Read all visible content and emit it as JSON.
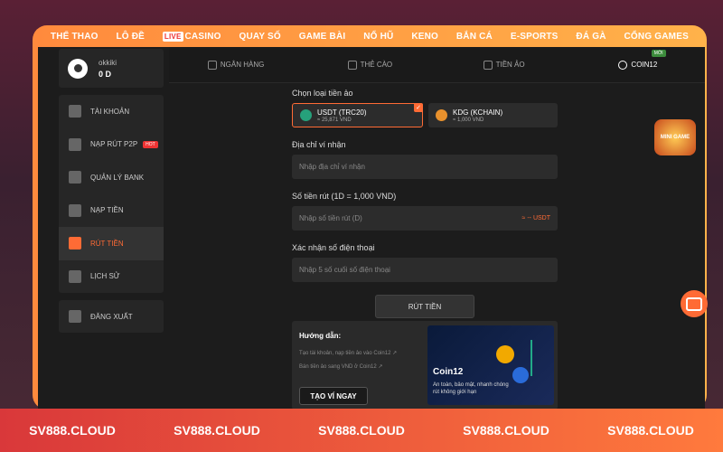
{
  "topnav": [
    "THỂ THAO",
    "LÔ ĐỀ",
    "CASINO",
    "QUAY SỐ",
    "GAME BÀI",
    "NỔ HŨ",
    "KENO",
    "BẮN CÁ",
    "E-SPORTS",
    "ĐÁ GÀ",
    "CỔNG GAMES"
  ],
  "live_badge": "LIVE",
  "user": {
    "name": "okkiki",
    "balance": "0 D"
  },
  "sidebar": {
    "items": [
      {
        "label": "TÀI KHOẢN",
        "icon": "account-icon"
      },
      {
        "label": "NẠP RÚT P2P",
        "icon": "p2p-icon",
        "badge": "HOT"
      },
      {
        "label": "QUẢN LÝ BANK",
        "icon": "bank-icon"
      },
      {
        "label": "NẠP TIỀN",
        "icon": "deposit-icon"
      },
      {
        "label": "RÚT TIỀN",
        "icon": "withdraw-icon",
        "active": true
      },
      {
        "label": "LỊCH SỬ",
        "icon": "history-icon"
      }
    ],
    "logout": "ĐĂNG XUẤT"
  },
  "tabs": [
    {
      "label": "NGÂN HÀNG",
      "icon": "bank-icon"
    },
    {
      "label": "THẺ CÀO",
      "icon": "card-icon"
    },
    {
      "label": "TIỀN ẢO",
      "icon": "crypto-icon"
    },
    {
      "label": "COIN12",
      "icon": "coin-icon",
      "badge": "MỚI",
      "active": true
    }
  ],
  "form": {
    "coin_label": "Chọn loại tiền ảo",
    "coins": [
      {
        "name": "USDT (TRC20)",
        "rate": "≈ 25,871 VND",
        "color": "#26a17b",
        "selected": true
      },
      {
        "name": "KDG (KCHAIN)",
        "rate": "≈ 1,000 VND",
        "color": "#e8912d",
        "selected": false
      }
    ],
    "wallet_label": "Địa chỉ ví nhận",
    "wallet_placeholder": "Nhập địa chỉ ví nhận",
    "amount_label": "Số tiền rút (1D = 1,000 VND)",
    "amount_placeholder": "Nhập số tiền rút (D)",
    "amount_conversion": "≈ -- USDT",
    "phone_label": "Xác nhận số điện thoại",
    "phone_placeholder": "Nhập 5 số cuối số điện thoại",
    "submit": "RÚT TIỀN"
  },
  "guide": {
    "title": "Hướng dẫn:",
    "links": [
      "Tạo tài khoản, nạp tiền ảo vào Coin12 ↗",
      "Bán tiền ảo sang VND ở Coin12 ↗"
    ],
    "button": "TẠO VÍ NGAY",
    "promo_logo": "Coin12",
    "promo_tagline": "An toàn, bảo mật, nhanh chóng rút không giới hạn"
  },
  "footer": [
    "SV888.CLOUD",
    "SV888.CLOUD",
    "SV888.CLOUD",
    "SV888.CLOUD",
    "SV888.CLOUD"
  ],
  "chip_text": "MINI GAME"
}
